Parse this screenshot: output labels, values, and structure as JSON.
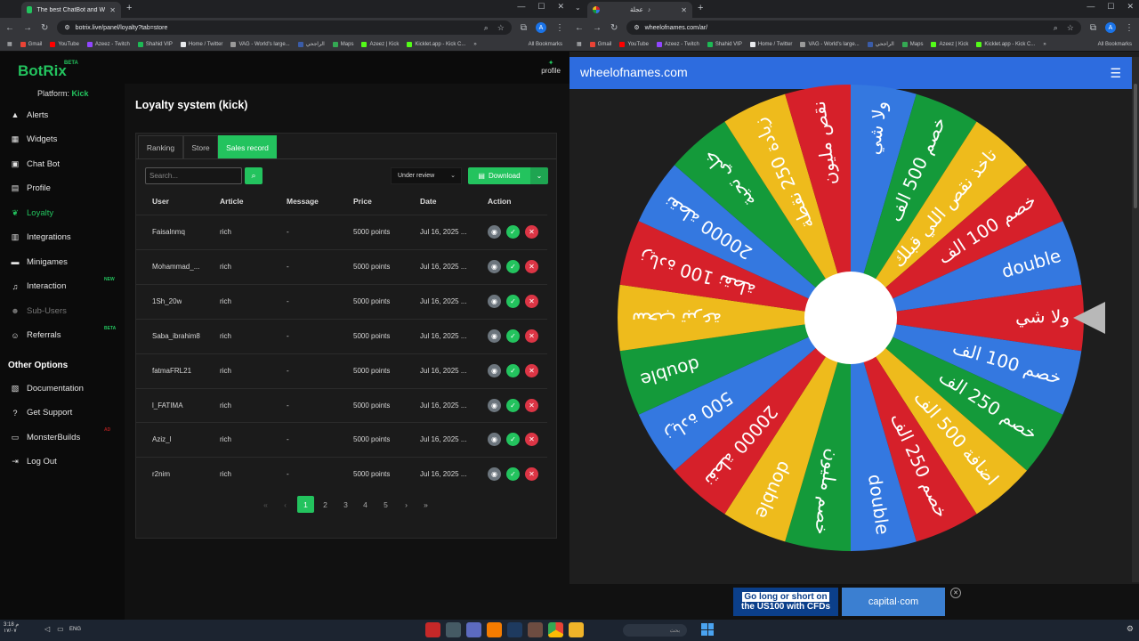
{
  "left_browser": {
    "tab_title": "The best ChatBot and Widgets",
    "url": "botrix.live/panel/loyalty?tab=store",
    "bookmarks": [
      "Gmail",
      "YouTube",
      "Azeez - Twitch",
      "Shahid VIP",
      "Home / Twitter",
      "VAG - World's large...",
      "الراجحي",
      "Maps",
      "Azeez | Kick",
      "Kicklet.app - Kick C..."
    ],
    "all_bookmarks": "All Bookmarks",
    "avatar_letter": "A"
  },
  "botrix": {
    "logo": "BotRix",
    "logo_badge": "BETA",
    "platform_label": "Platform:",
    "platform_value": "Kick",
    "profile_label": "profile",
    "nav": [
      {
        "label": "Alerts",
        "icon": "bell-icon",
        "glyph": "▲"
      },
      {
        "label": "Widgets",
        "icon": "grid-icon",
        "glyph": "▦"
      },
      {
        "label": "Chat Bot",
        "icon": "chat-icon",
        "glyph": "▣"
      },
      {
        "label": "Profile",
        "icon": "id-card-icon",
        "glyph": "▤"
      },
      {
        "label": "Loyalty",
        "icon": "leaf-icon",
        "glyph": "❦",
        "active": true
      },
      {
        "label": "Integrations",
        "icon": "puzzle-icon",
        "glyph": "▥"
      },
      {
        "label": "Minigames",
        "icon": "gamepad-icon",
        "glyph": "▬"
      },
      {
        "label": "Interaction",
        "icon": "music-icon",
        "glyph": "♫",
        "badge": "NEW"
      },
      {
        "label": "Sub-Users",
        "icon": "users-icon",
        "glyph": "☻",
        "dim": true
      },
      {
        "label": "Referrals",
        "icon": "people-icon",
        "glyph": "☺",
        "badge": "BETA"
      }
    ],
    "other_options_title": "Other Options",
    "other_nav": [
      {
        "label": "Documentation",
        "icon": "book-icon",
        "glyph": "▧"
      },
      {
        "label": "Get Support",
        "icon": "help-icon",
        "glyph": "?"
      },
      {
        "label": "MonsterBuilds",
        "icon": "monitor-icon",
        "glyph": "▭",
        "badge": "AD"
      },
      {
        "label": "Log Out",
        "icon": "logout-icon",
        "glyph": "⇥"
      }
    ],
    "page_title": "Loyalty system (kick)",
    "tabs": [
      "Ranking",
      "Store",
      "Sales record"
    ],
    "active_tab": "Sales record",
    "search_placeholder": "Search...",
    "filter_value": "Under review",
    "download_label": "Download",
    "columns": [
      "User",
      "Article",
      "Message",
      "Price",
      "Date",
      "Action"
    ],
    "rows": [
      {
        "user": "Faisalnmq",
        "article": "rich",
        "message": "-",
        "price": "5000 points",
        "date": "Jul 16, 2025 ..."
      },
      {
        "user": "Mohammad_...",
        "article": "rich",
        "message": "-",
        "price": "5000 points",
        "date": "Jul 16, 2025 ..."
      },
      {
        "user": "1Sh_20w",
        "article": "rich",
        "message": "-",
        "price": "5000 points",
        "date": "Jul 16, 2025 ..."
      },
      {
        "user": "Saba_ibrahim8",
        "article": "rich",
        "message": "-",
        "price": "5000 points",
        "date": "Jul 16, 2025 ..."
      },
      {
        "user": "fatmaFRL21",
        "article": "rich",
        "message": "-",
        "price": "5000 points",
        "date": "Jul 16, 2025 ..."
      },
      {
        "user": "l_FATIMA",
        "article": "rich",
        "message": "-",
        "price": "5000 points",
        "date": "Jul 16, 2025 ..."
      },
      {
        "user": "Aziz_l",
        "article": "rich",
        "message": "-",
        "price": "5000 points",
        "date": "Jul 16, 2025 ..."
      },
      {
        "user": "r2nim",
        "article": "rich",
        "message": "-",
        "price": "5000 points",
        "date": "Jul 16, 2025 ..."
      }
    ],
    "pagination": [
      "«",
      "‹",
      "1",
      "2",
      "3",
      "4",
      "5",
      "›",
      "»"
    ],
    "current_page": "1",
    "accent": "#23c35e"
  },
  "right_browser": {
    "tab_title": "عجلة",
    "url": "wheelofnames.com/ar/",
    "bookmarks": [
      "Gmail",
      "YouTube",
      "Azeez - Twitch",
      "Shahid VIP",
      "Home / Twitter",
      "VAG - World's large...",
      "الراجحي",
      "Maps",
      "Azeez | Kick",
      "Kicklet.app - Kick C..."
    ],
    "all_bookmarks": "All Bookmarks",
    "avatar_letter": "A"
  },
  "wheel": {
    "site_title": "wheelofnames.com",
    "colors": [
      "#d6202a",
      "#3478e0",
      "#149a3a",
      "#eebb1c"
    ],
    "segments": [
      "ولا شي",
      "خصم 100 الف",
      "خصم 250 الف",
      "اضافة 500 الف",
      "خصم 250 الف",
      "double",
      "خصم مليون",
      "double",
      "20000 نقطة",
      "زيادة 500",
      "double",
      "سحب تبرعة",
      "زيادة 100 نقطة",
      "20000 نقطة",
      "خلي تحية",
      "زيادة 250 نقطة",
      "نقص مليون",
      "ولا شي",
      "خصم 500 الف",
      "تاخذ نقص اللي قبلك",
      "خصم 100 الف",
      "double"
    ],
    "ad_line1": "Go long or short on",
    "ad_line2": "the US100 with CFDs",
    "ad_brand": "capital·com"
  },
  "taskbar": {
    "time": "3:18 م",
    "date": "١٧/٠٧",
    "lang": "ENG",
    "search_label": "بحث"
  }
}
